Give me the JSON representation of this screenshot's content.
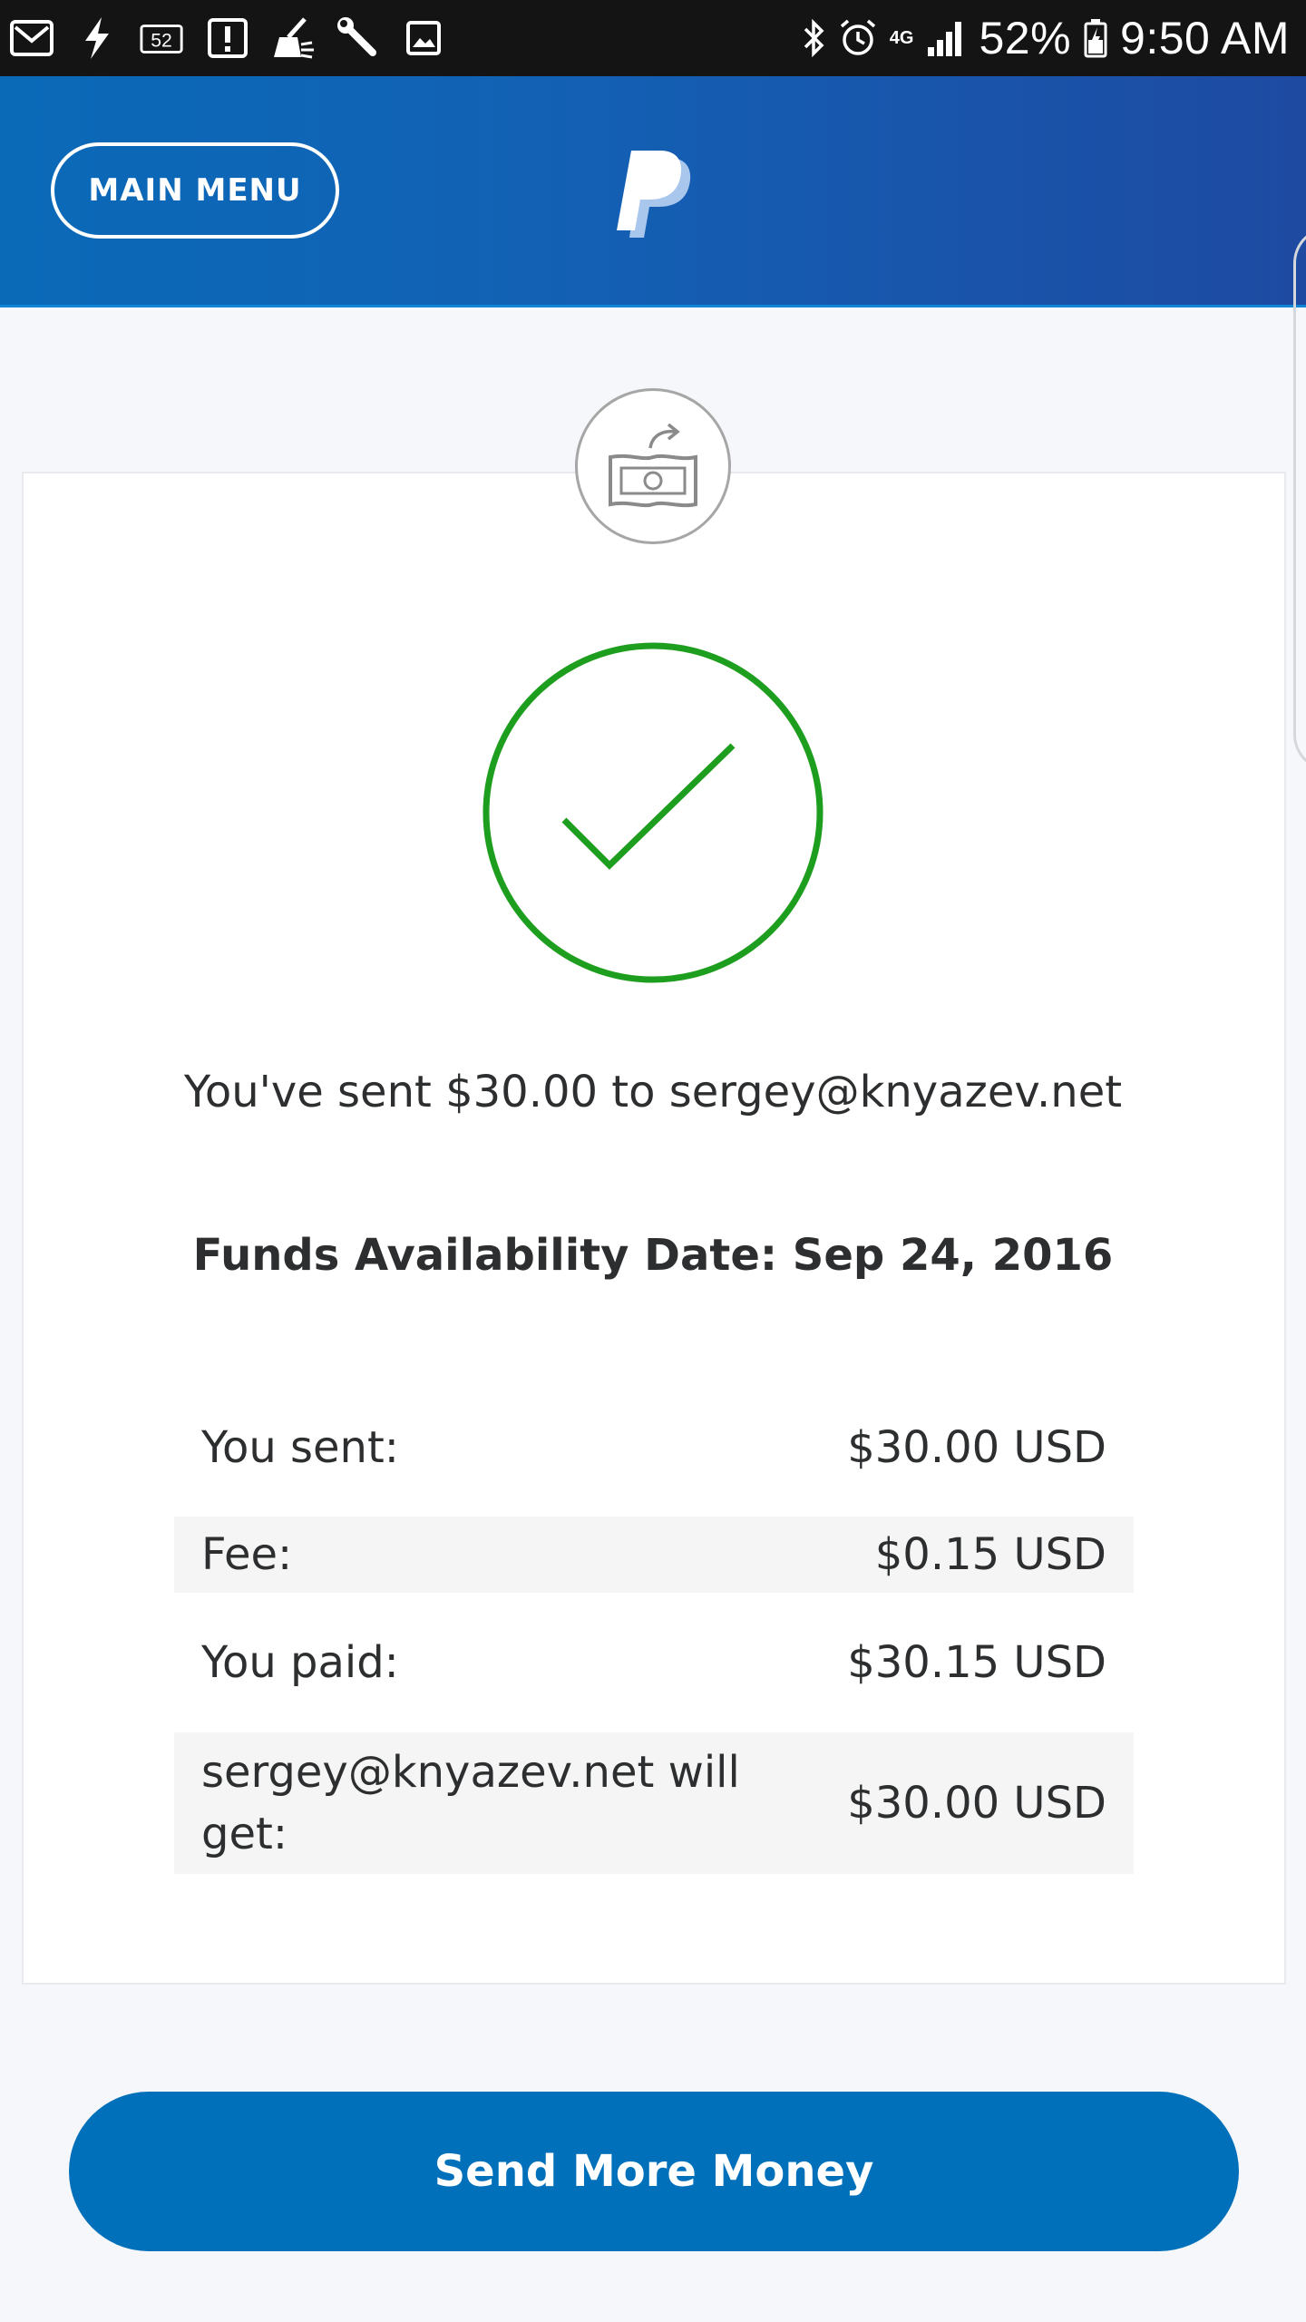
{
  "status_bar": {
    "left_icons": [
      "mail-icon",
      "flash-icon",
      "notification-count-icon",
      "alert-icon",
      "cleaner-icon",
      "wrench-icon",
      "image-icon"
    ],
    "notification_count": "52",
    "network_label": "4G",
    "battery_percent": "52%",
    "time": "9:50 AM",
    "right_icons": [
      "bluetooth-icon",
      "alarm-icon",
      "network-4g-icon",
      "signal-icon",
      "battery-icon"
    ]
  },
  "header": {
    "main_menu_label": "MAIN MENU",
    "logo": "paypal-logo",
    "colors": {
      "gradient_start": "#0a6ab8",
      "gradient_end": "#1e4aa2"
    }
  },
  "confirmation": {
    "badge_icon": "send-money-icon",
    "status_icon": "success-check-icon",
    "message": "You've sent $30.00 to sergey@knyazev.net",
    "availability": "Funds Availability Date: Sep 24, 2016",
    "summary": [
      {
        "label": "You sent:",
        "value": "$30.00 USD"
      },
      {
        "label": "Fee:",
        "value": "$0.15 USD"
      },
      {
        "label": "You paid:",
        "value": "$30.15 USD"
      },
      {
        "label": "sergey@knyazev.net will get:",
        "value": "$30.00 USD"
      }
    ]
  },
  "actions": {
    "send_more_label": "Send More Money"
  },
  "colors": {
    "accent": "#0070ba",
    "success": "#1e9e1e"
  }
}
